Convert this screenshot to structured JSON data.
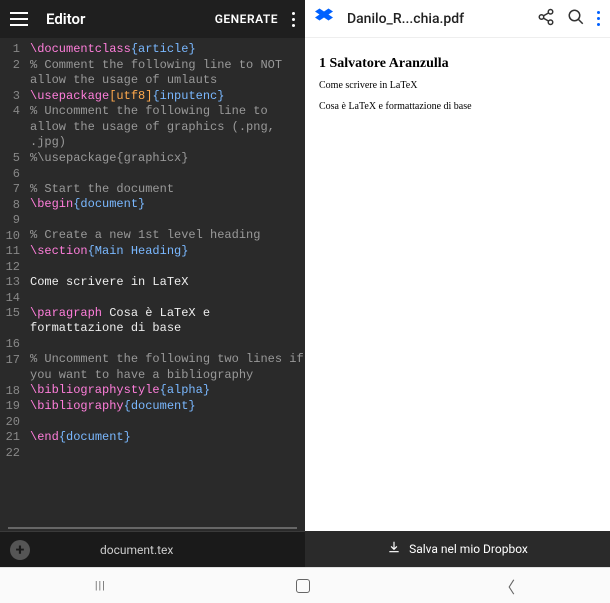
{
  "editor": {
    "title": "Editor",
    "generate": "GENERATE",
    "filename": "document.tex",
    "lines": [
      {
        "n": "1",
        "seg": [
          {
            "c": "cmd",
            "t": "\\documentclass"
          },
          {
            "c": "arg",
            "t": "{article}"
          }
        ]
      },
      {
        "n": "2",
        "seg": [
          {
            "c": "comment",
            "t": "% Comment the following line to NOT allow the usage of umlauts"
          }
        ],
        "wrap": true
      },
      {
        "n": "3",
        "seg": [
          {
            "c": "cmd",
            "t": "\\usepackage"
          },
          {
            "c": "opt",
            "t": "[utf8]"
          },
          {
            "c": "arg",
            "t": "{inputenc}"
          }
        ]
      },
      {
        "n": "4",
        "seg": [
          {
            "c": "comment",
            "t": "% Uncomment the following line to allow the usage of graphics (.png, .jpg)"
          }
        ],
        "wrap": true
      },
      {
        "n": "5",
        "seg": [
          {
            "c": "comment",
            "t": "%\\usepackage{graphicx}"
          }
        ]
      },
      {
        "n": "6",
        "seg": []
      },
      {
        "n": "7",
        "seg": [
          {
            "c": "comment",
            "t": "% Start the document"
          }
        ]
      },
      {
        "n": "8",
        "seg": [
          {
            "c": "cmd",
            "t": "\\begin"
          },
          {
            "c": "arg",
            "t": "{document}"
          }
        ]
      },
      {
        "n": "9",
        "seg": []
      },
      {
        "n": "10",
        "seg": [
          {
            "c": "comment",
            "t": "% Create a new 1st level heading"
          }
        ]
      },
      {
        "n": "11",
        "seg": [
          {
            "c": "cmd",
            "t": "\\section"
          },
          {
            "c": "arg",
            "t": "{Main Heading}"
          }
        ]
      },
      {
        "n": "12",
        "seg": []
      },
      {
        "n": "13",
        "seg": [
          {
            "c": "plain",
            "t": "Come scrivere in LaTeX"
          }
        ]
      },
      {
        "n": "14",
        "seg": []
      },
      {
        "n": "15",
        "seg": [
          {
            "c": "cmd",
            "t": "\\paragraph"
          },
          {
            "c": "plain",
            "t": " Cosa è LaTeX e formattazione di base"
          }
        ],
        "wrap": true
      },
      {
        "n": "16",
        "seg": []
      },
      {
        "n": "17",
        "seg": [
          {
            "c": "comment",
            "t": "% Uncomment the following two lines if you want to have a bibliography"
          }
        ],
        "wrap": true
      },
      {
        "n": "18",
        "seg": [
          {
            "c": "cmd",
            "t": "\\bibliographystyle"
          },
          {
            "c": "arg",
            "t": "{alpha}"
          }
        ]
      },
      {
        "n": "19",
        "seg": [
          {
            "c": "cmd",
            "t": "\\bibliography"
          },
          {
            "c": "arg",
            "t": "{document}"
          }
        ]
      },
      {
        "n": "20",
        "seg": []
      },
      {
        "n": "21",
        "seg": [
          {
            "c": "cmd",
            "t": "\\end"
          },
          {
            "c": "arg",
            "t": "{document}"
          }
        ]
      },
      {
        "n": "22",
        "seg": []
      }
    ]
  },
  "pdf": {
    "filename": "Danilo_R...chia.pdf",
    "section": "1   Salvatore Aranzulla",
    "line1": "Come scrivere in LaTeX",
    "line2": "Cosa è LaTeX e formattazione di base",
    "save": "Salva nel mio Dropbox"
  }
}
